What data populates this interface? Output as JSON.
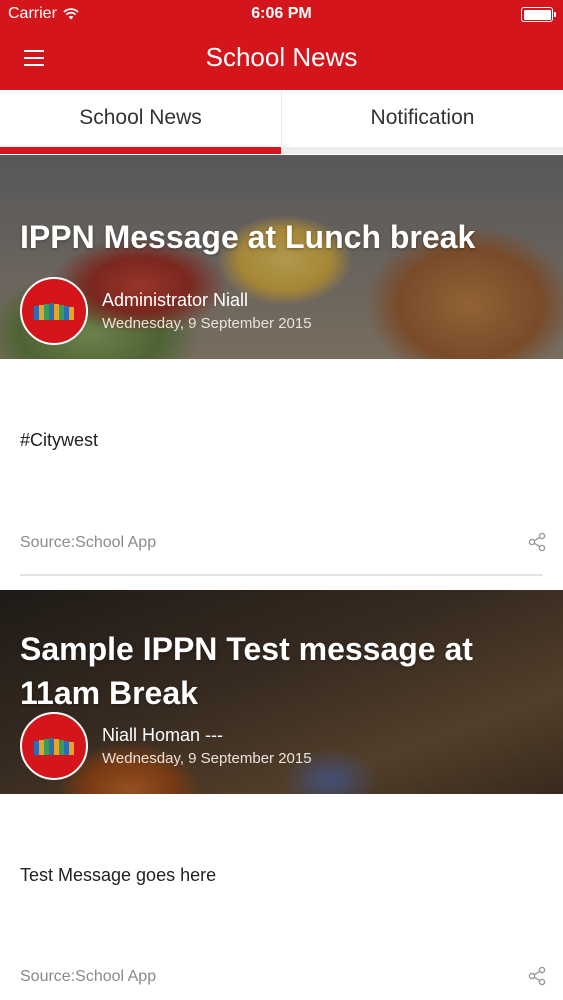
{
  "status_bar": {
    "carrier": "Carrier",
    "time": "6:06 PM"
  },
  "header": {
    "title": "School News"
  },
  "tabs": [
    {
      "label": "School News",
      "active": true
    },
    {
      "label": "Notification",
      "active": false
    }
  ],
  "posts": [
    {
      "title": "IPPN Message at Lunch break",
      "author": "Administrator Niall",
      "date": "Wednesday, 9 September 2015",
      "body": "#Citywest",
      "source": "Source:School App"
    },
    {
      "title": "Sample IPPN Test message at 11am Break",
      "author": "Niall Homan ---",
      "date": "Wednesday, 9 September 2015",
      "body": "Test Message goes here",
      "source": "Source:School App"
    }
  ],
  "colors": {
    "brand_red": "#d4161c"
  }
}
